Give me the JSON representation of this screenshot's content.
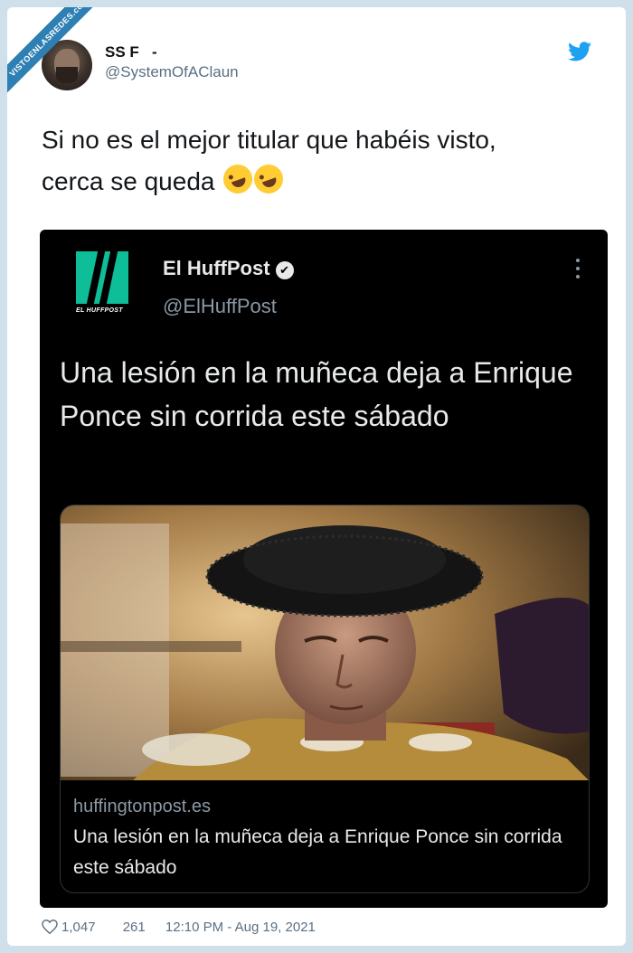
{
  "watermark": "VISTOENLASREDES.com",
  "tweet": {
    "display_name": "SS F   -",
    "handle": "@SystemOfAClaun",
    "text": "Si no es el mejor titular que habéis visto,\ncerca se queda",
    "likes": "1,047",
    "replies": "261",
    "timestamp": "12:10 PM - Aug 19, 2021"
  },
  "embed": {
    "logo_caption": "EL HUFFPOST",
    "name": "El HuffPost",
    "verified_mark": "✔",
    "handle": "@ElHuffPost",
    "headline": "Una lesión en la muñeca deja a Enrique Ponce sin corrida este sábado",
    "card": {
      "domain": "huffingtonpost.es",
      "title": "Una lesión en la muñeca deja a Enrique Ponce sin corrida este sábado"
    }
  },
  "colors": {
    "twitter_blue": "#1da1f2",
    "huffpost_green": "#0dbe98",
    "embed_bg": "#000000"
  },
  "icons": [
    "twitter-bird-icon",
    "verified-icon",
    "more-icon",
    "heart-icon",
    "emoji-rofl-icon"
  ]
}
